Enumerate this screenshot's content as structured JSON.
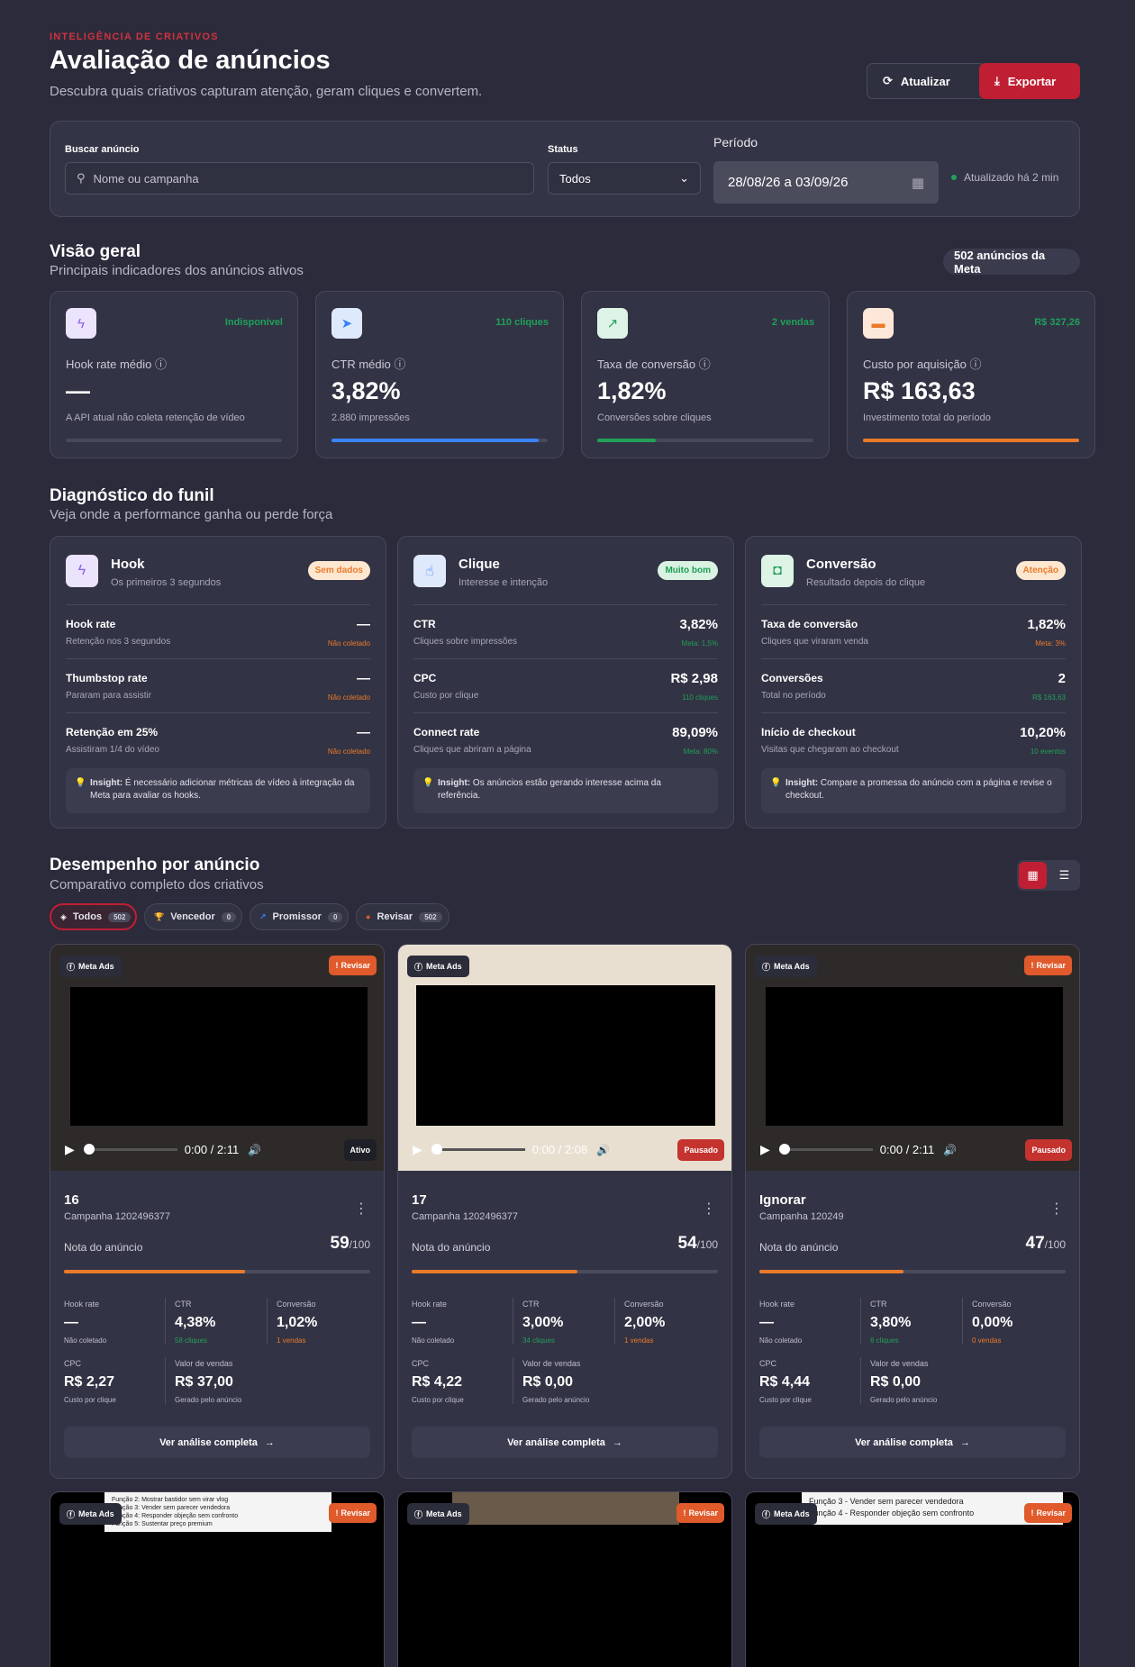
{
  "header": {
    "eyebrow": "INTELIGÊNCIA DE CRIATIVOS",
    "title": "Avaliação de anúncios",
    "subtitle": "Descubra quais criativos capturam atenção, geram cliques e convertem.",
    "update_label": "Atualizar",
    "export_label": "Exportar"
  },
  "filters": {
    "search_label": "Buscar anúncio",
    "search_placeholder": "Nome ou campanha",
    "status_label": "Status",
    "status_value": "Todos",
    "period_label": "Período",
    "period_value": "28/08/26 a 03/09/26",
    "updated": "Atualizado há 2 min"
  },
  "overview": {
    "title": "Visão geral",
    "subtitle": "Principais indicadores dos anúncios ativos",
    "count": "502 anúncios da Meta",
    "kpis": [
      {
        "label": "Hook rate médio",
        "value": "—",
        "hint": "A API atual não coleta retenção de vídeo",
        "trend": "Indisponível",
        "icon": "bolt-icon",
        "color": "#8b5cf6",
        "progress": 0
      },
      {
        "label": "CTR médio",
        "value": "3,82%",
        "hint": "2.880 impressões",
        "trend": "110 cliques",
        "icon": "cursor-icon",
        "color": "#3b82f6",
        "progress": 0.96
      },
      {
        "label": "Taxa de conversão",
        "value": "1,82%",
        "hint": "Conversões sobre cliques",
        "trend": "2 vendas",
        "icon": "chart-icon",
        "color": "#22a05a",
        "progress": 0.27
      },
      {
        "label": "Custo por aquisição",
        "value": "R$ 163,63",
        "hint": "Investimento total do período",
        "trend": "R$ 327,26",
        "icon": "wallet-icon",
        "color": "#ea7a2b",
        "progress": 1
      }
    ]
  },
  "funnel": {
    "title": "Diagnóstico do funil",
    "subtitle": "Veja onde a performance ganha ou perde força",
    "stages": [
      {
        "name": "Hook",
        "desc": "Os primeiros 3 segundos",
        "badge": "Sem dados",
        "badge_color": "#ea7a2b",
        "rows": [
          {
            "name": "Hook rate",
            "desc": "Retenção nos 3 segundos",
            "value": "—",
            "meta": "Não coletado",
            "meta_color": "#ea7a2b"
          },
          {
            "name": "Thumbstop rate",
            "desc": "Pararam para assistir",
            "value": "—",
            "meta": "Não coletado",
            "meta_color": "#ea7a2b"
          },
          {
            "name": "Retenção em 25%",
            "desc": "Assistiram 1/4 do vídeo",
            "value": "—",
            "meta": "Não coletado",
            "meta_color": "#ea7a2b"
          }
        ],
        "insight_label": "Insight:",
        "insight": " É necessário adicionar métricas de vídeo à integração da Meta para avaliar os hooks."
      },
      {
        "name": "Clique",
        "desc": "Interesse e intenção",
        "badge": "Muito bom",
        "badge_color": "#1e9e55",
        "rows": [
          {
            "name": "CTR",
            "desc": "Cliques sobre impressões",
            "value": "3,82%",
            "meta": "Meta: 1,5%",
            "meta_color": "#22a05a"
          },
          {
            "name": "CPC",
            "desc": "Custo por clique",
            "value": "R$ 2,98",
            "meta": "110 cliques",
            "meta_color": "#22a05a"
          },
          {
            "name": "Connect rate",
            "desc": "Cliques que abriram a página",
            "value": "89,09%",
            "meta": "Meta: 80%",
            "meta_color": "#22a05a"
          }
        ],
        "insight_label": "Insight:",
        "insight": " Os anúncios estão gerando interesse acima da referência."
      },
      {
        "name": "Conversão",
        "desc": "Resultado depois do clique",
        "badge": "Atenção",
        "badge_color": "#ea7a2b",
        "rows": [
          {
            "name": "Taxa de conversão",
            "desc": "Cliques que viraram venda",
            "value": "1,82%",
            "meta": "Meta: 3%",
            "meta_color": "#ea7a2b"
          },
          {
            "name": "Conversões",
            "desc": "Total no período",
            "value": "2",
            "meta": "R$ 163,63",
            "meta_color": "#22a05a"
          },
          {
            "name": "Início de checkout",
            "desc": "Visitas que chegaram ao checkout",
            "value": "10,20%",
            "meta": "10 eventos",
            "meta_color": "#22a05a"
          }
        ],
        "insight_label": "Insight:",
        "insight": " Compare a promessa do anúncio com a página e revise o checkout."
      }
    ]
  },
  "performance": {
    "title": "Desempenho por anúncio",
    "subtitle": "Comparativo completo dos criativos",
    "chips": [
      {
        "label": "Todos",
        "count": "502",
        "icon": "layers-icon"
      },
      {
        "label": "Vencedor",
        "count": "0",
        "icon": "trophy-icon"
      },
      {
        "label": "Promissor",
        "count": "0",
        "icon": "trend-icon"
      },
      {
        "label": "Revisar",
        "count": "502",
        "icon": "alert-icon"
      }
    ],
    "meta_ads": "Meta Ads",
    "review": "Revisar",
    "score_label": "Nota do anúncio",
    "score_max": "/100",
    "cta": "Ver análise completa",
    "labels": {
      "hook": "Hook rate",
      "ctr": "CTR",
      "conv": "Conversão",
      "cpc": "CPC",
      "sales": "Valor de vendas",
      "cpc_desc": "Custo por clique",
      "sales_desc": "Gerado pelo anúncio"
    },
    "cards": [
      {
        "name": "16",
        "campaign": "Campanha 1202496377",
        "score": "59",
        "score_pct": 0.59,
        "time": "0:00 / 2:11",
        "state": "Ativo",
        "hook": "—",
        "hook_sub": "Não coletado",
        "ctr": "4,38%",
        "ctr_sub": "58 cliques",
        "conv": "1,02%",
        "conv_sub": "1 vendas",
        "cpc": "R$ 2,27",
        "sales": "R$ 37,00",
        "badge": "Revisar"
      },
      {
        "name": "17",
        "campaign": "Campanha 1202496377",
        "score": "54",
        "score_pct": 0.54,
        "time": "0:00 / 2:08",
        "state": "Pausado",
        "hook": "—",
        "hook_sub": "Não coletado",
        "ctr": "3,00%",
        "ctr_sub": "34 cliques",
        "conv": "2,00%",
        "conv_sub": "1 vendas",
        "cpc": "R$ 4,22",
        "sales": "R$ 0,00",
        "badge": ""
      },
      {
        "name": "Ignorar",
        "campaign": "Campanha 120249",
        "score": "47",
        "score_pct": 0.47,
        "time": "0:00 / 2:11",
        "state": "Pausado",
        "hook": "—",
        "hook_sub": "Não coletado",
        "ctr": "3,80%",
        "ctr_sub": "6 cliques",
        "conv": "0,00%",
        "conv_sub": "0 vendas",
        "cpc": "R$ 4,44",
        "sales": "R$ 0,00",
        "badge": "Revisar"
      }
    ],
    "second_row_texts": [
      [
        "Função 2: Mostrar bastidor sem virar vlog",
        "Função 3: Vender sem parecer vendedora",
        "Função 4: Responder objeção sem confronto",
        "Função 5: Sustentar preço premium"
      ],
      [],
      [
        "Função 3 - Vender sem parecer vendedora",
        "Função 4 - Responder objeção sem confronto"
      ]
    ]
  }
}
